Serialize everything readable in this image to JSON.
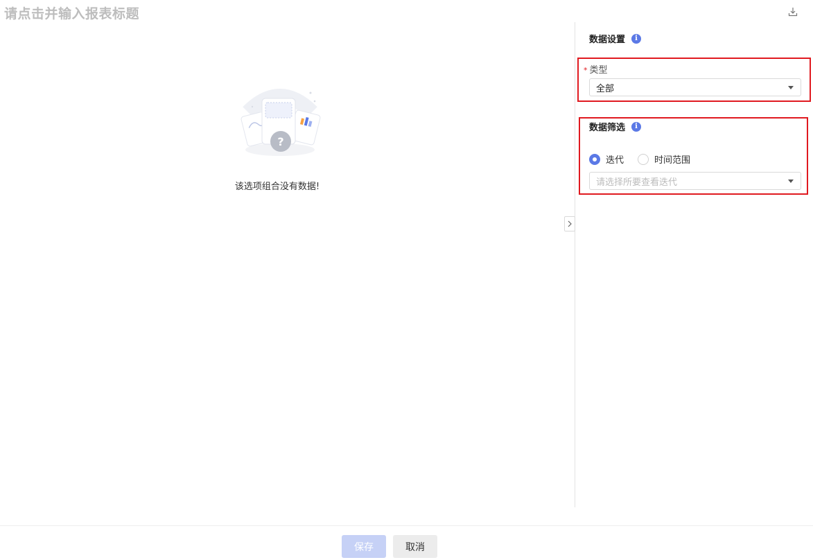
{
  "header": {
    "title_placeholder": "请点击并输入报表标题",
    "download_icon": "download-icon"
  },
  "main": {
    "empty_state_text": "该选项组合没有数据!",
    "empty_icon": "no-data-illustration"
  },
  "panel": {
    "data_settings": {
      "title": "数据设置",
      "info_icon": "i"
    },
    "type_field": {
      "required_mark": "*",
      "label": "类型",
      "selected_value": "全部"
    },
    "data_filter": {
      "title": "数据筛选",
      "info_icon": "i",
      "radios": [
        {
          "label": "迭代",
          "checked": true
        },
        {
          "label": "时间范围",
          "checked": false
        }
      ],
      "iteration_select_placeholder": "请选择所要查看迭代"
    }
  },
  "footer": {
    "save_label": "保存",
    "cancel_label": "取消"
  },
  "colors": {
    "accent": "#5b79e6",
    "highlight_border": "#e0191f",
    "save_disabled": "#c6d1f6"
  }
}
